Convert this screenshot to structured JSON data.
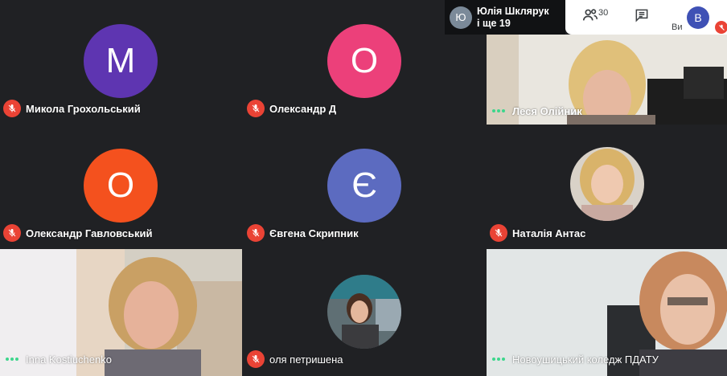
{
  "presenter": {
    "initial": "Ю",
    "line1": "Юлія Шклярук",
    "line2": "і ще 19"
  },
  "topbar": {
    "participants_count": "30",
    "self_initial": "B",
    "self_label": "Ви"
  },
  "colors": {
    "muted_mic": "#ea4335",
    "speaking": "#3dd68c",
    "background": "#202124"
  },
  "tiles": [
    {
      "name": "Микола Грохольський",
      "initial": "М",
      "color": "#5e35b1",
      "muted": true
    },
    {
      "name": "Олександр Д",
      "initial": "О",
      "color": "#ec407a",
      "muted": true
    },
    {
      "name": "Леся Олійник",
      "video": true,
      "muted": false
    },
    {
      "name": "Олександр Гавловський",
      "initial": "О",
      "color": "#f4511e",
      "muted": true
    },
    {
      "name": "Євгена Скрипник",
      "initial": "Є",
      "color": "#5c6bc0",
      "muted": true
    },
    {
      "name": "Наталія Антас",
      "photo": true,
      "muted": true
    },
    {
      "name": "Inna Kostiuchenko",
      "video": true,
      "muted": false
    },
    {
      "name": "оля петришена",
      "photo": true,
      "muted": true
    },
    {
      "name": "Новоушицький коледж ПДАТУ",
      "video": true,
      "muted": false
    }
  ]
}
